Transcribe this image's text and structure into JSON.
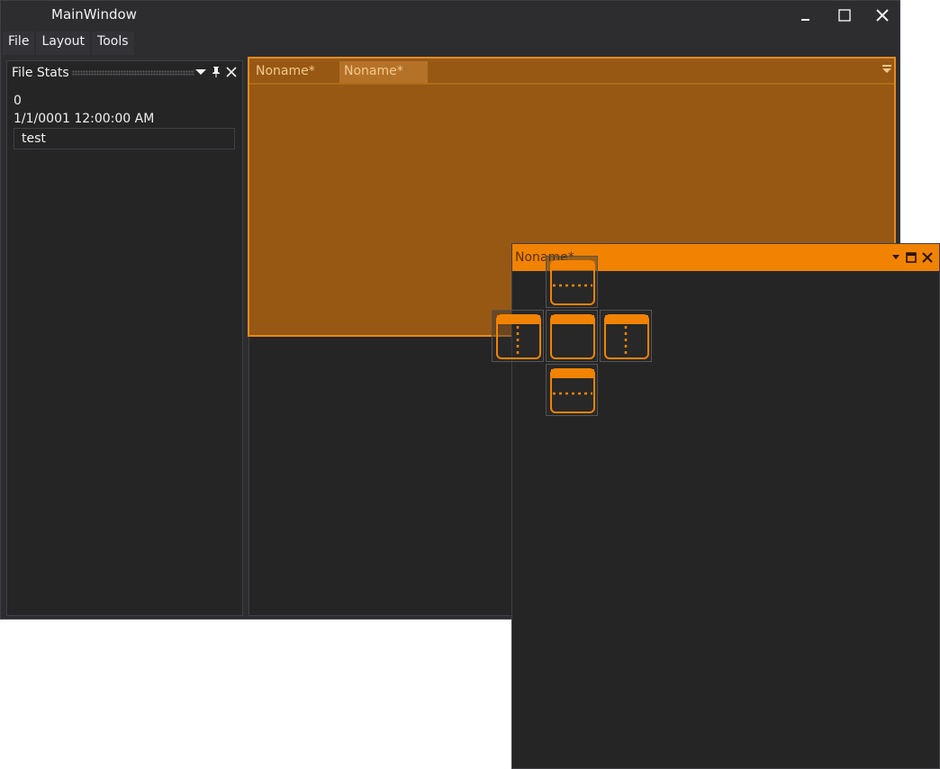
{
  "window": {
    "title": "MainWindow"
  },
  "menu": {
    "items": [
      "File",
      "Layout",
      "Tools"
    ]
  },
  "file_stats": {
    "title": "File Stats",
    "count": "0",
    "date": "1/1/0001 12:00:00 AM",
    "text_value": "test"
  },
  "documents": {
    "tabs": [
      "Noname*",
      "Noname*"
    ],
    "floating_title": "Noname*"
  },
  "colors": {
    "accent": "#f28300",
    "background": "#2d2d30",
    "panel": "#252526"
  }
}
